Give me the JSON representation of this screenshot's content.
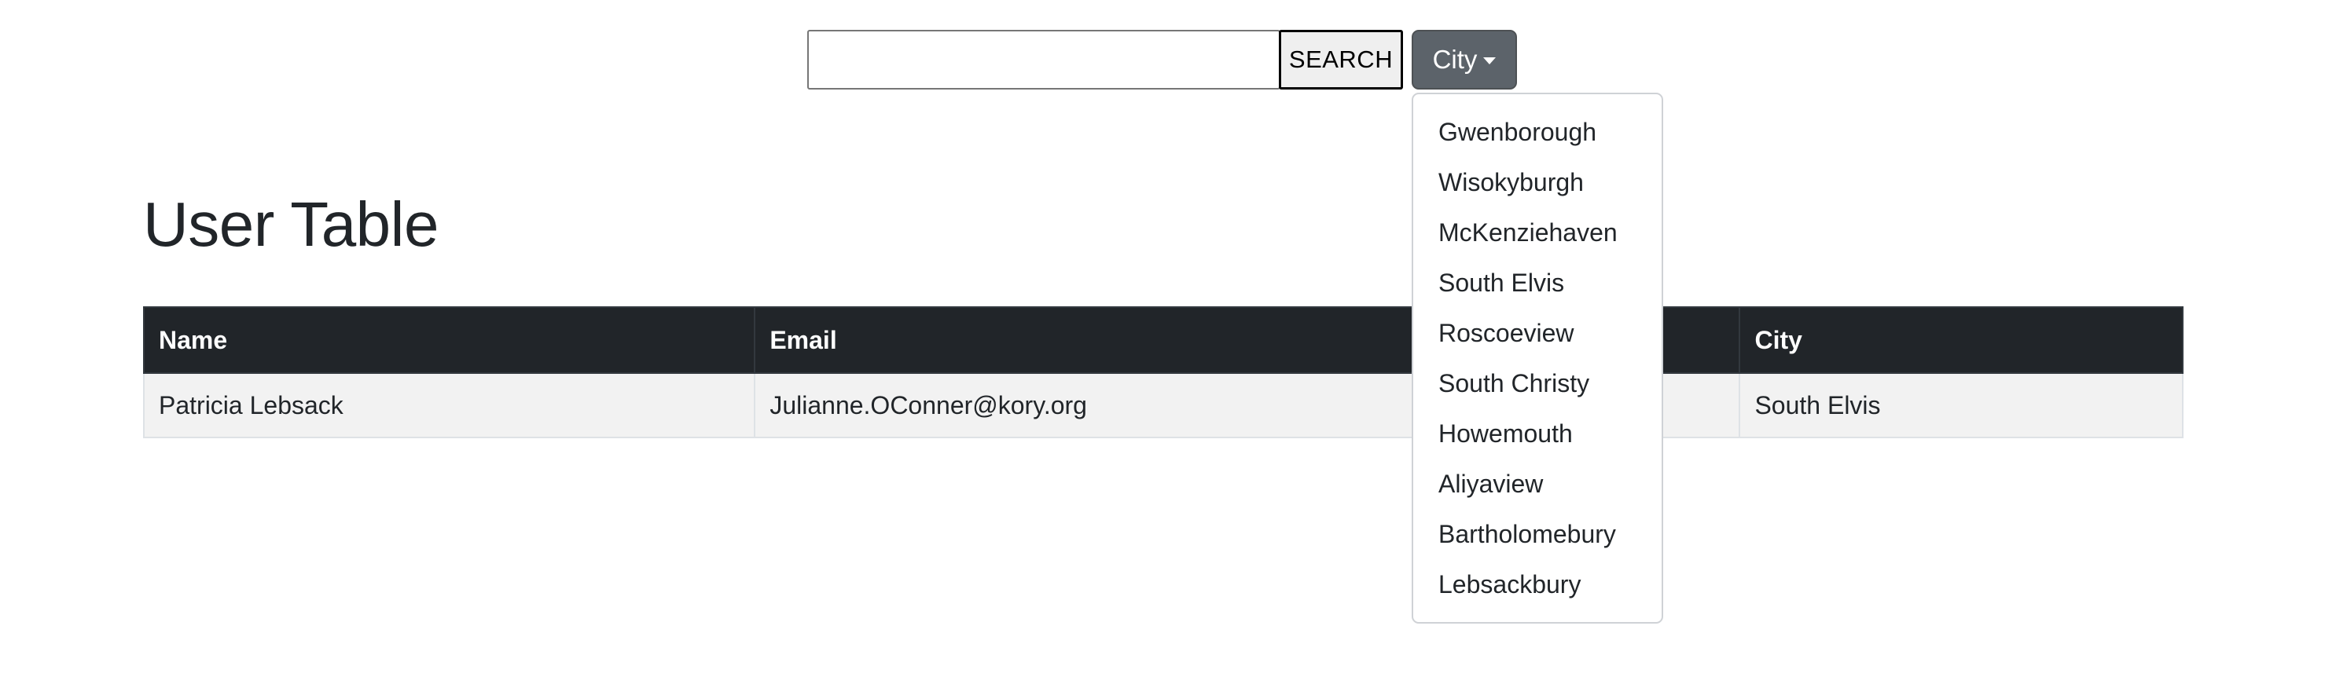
{
  "search": {
    "value": "",
    "placeholder": "",
    "button_label": "SEARCH"
  },
  "city_filter": {
    "toggle_label": "City",
    "options": [
      "Gwenborough",
      "Wisokyburgh",
      "McKenziehaven",
      "South Elvis",
      "Roscoeview",
      "South Christy",
      "Howemouth",
      "Aliyaview",
      "Bartholomebury",
      "Lebsackbury"
    ]
  },
  "page": {
    "title": "User Table"
  },
  "table": {
    "columns": [
      "Name",
      "Email",
      "City"
    ],
    "rows": [
      [
        "Patricia Lebsack",
        "Julianne.OConner@kory.org",
        "South Elvis"
      ]
    ]
  },
  "colors": {
    "header_bg": "#212529",
    "row_bg": "#f2f2f2",
    "toggle_bg": "#5c636a"
  }
}
